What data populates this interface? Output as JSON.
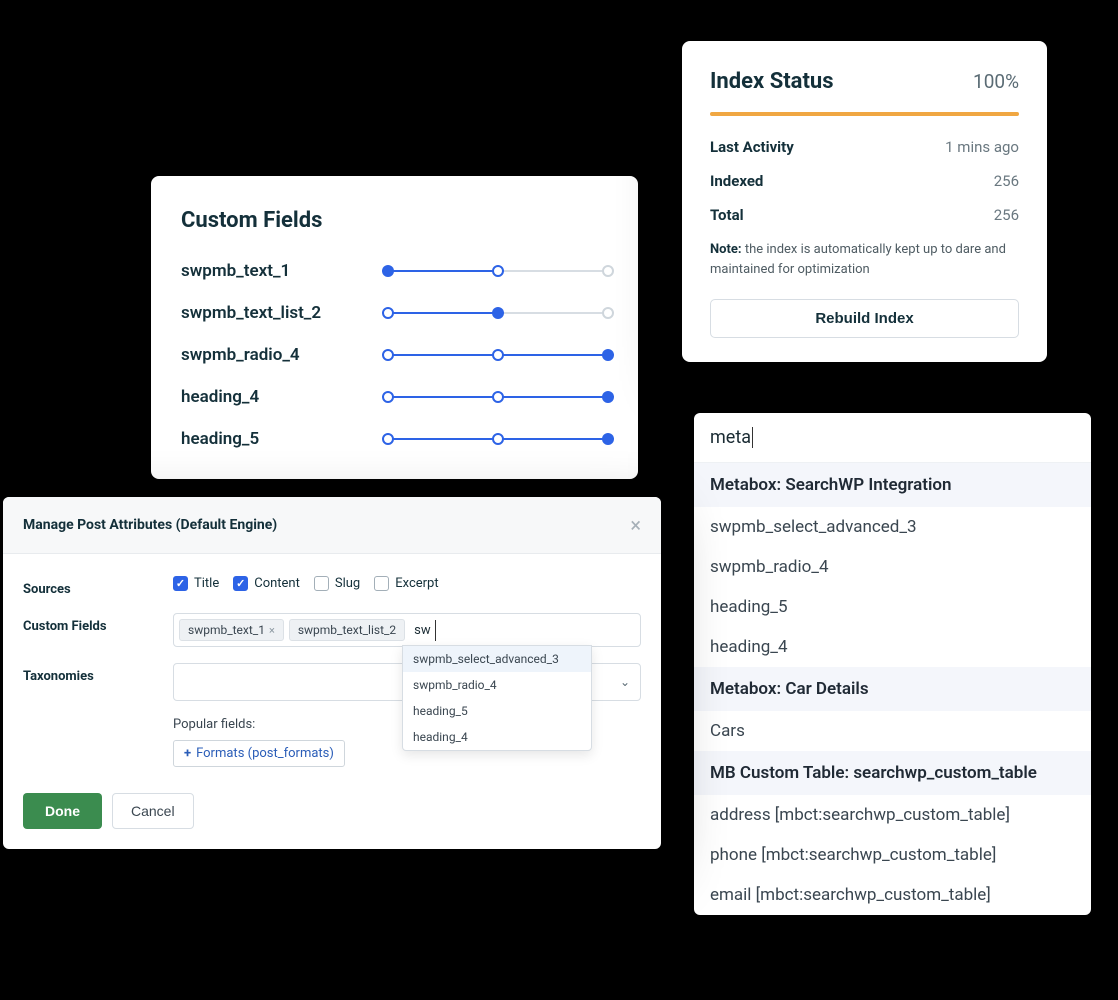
{
  "custom_fields_panel": {
    "title": "Custom Fields",
    "rows": [
      {
        "label": "swpmb_text_1",
        "fill_pct": 50,
        "dots": [
          {
            "type": "filled",
            "pos": 0
          },
          {
            "type": "open",
            "pos": 50
          },
          {
            "type": "grey",
            "pos": 100
          }
        ]
      },
      {
        "label": "swpmb_text_list_2",
        "fill_pct": 50,
        "dots": [
          {
            "type": "open",
            "pos": 0
          },
          {
            "type": "filled",
            "pos": 50
          },
          {
            "type": "grey",
            "pos": 100
          }
        ]
      },
      {
        "label": "swpmb_radio_4",
        "fill_pct": 100,
        "dots": [
          {
            "type": "open",
            "pos": 0
          },
          {
            "type": "open",
            "pos": 50
          },
          {
            "type": "filled",
            "pos": 100
          }
        ]
      },
      {
        "label": "heading_4",
        "fill_pct": 100,
        "dots": [
          {
            "type": "open",
            "pos": 0
          },
          {
            "type": "open",
            "pos": 50
          },
          {
            "type": "filled",
            "pos": 100
          }
        ]
      },
      {
        "label": "heading_5",
        "fill_pct": 100,
        "dots": [
          {
            "type": "open",
            "pos": 0
          },
          {
            "type": "open",
            "pos": 50
          },
          {
            "type": "filled",
            "pos": 100
          }
        ]
      }
    ]
  },
  "index_status": {
    "title": "Index Status",
    "percent": "100%",
    "rows": [
      {
        "label": "Last Activity",
        "value": "1 mins ago"
      },
      {
        "label": "Indexed",
        "value": "256"
      },
      {
        "label": "Total",
        "value": "256"
      }
    ],
    "note_bold": "Note:",
    "note_text": " the index is automatically kept up to dare and maintained for optimization",
    "button": "Rebuild Index"
  },
  "autocomplete": {
    "query": "meta",
    "groups": [
      {
        "header": "Metabox: SearchWP Integration",
        "items": [
          "swpmb_select_advanced_3",
          "swpmb_radio_4",
          "heading_5",
          "heading_4"
        ]
      },
      {
        "header": "Metabox: Car Details",
        "items": [
          "Cars"
        ]
      },
      {
        "header": "MB Custom Table: searchwp_custom_table",
        "items": [
          "address [mbct:searchwp_custom_table]",
          "phone [mbct:searchwp_custom_table]",
          "email [mbct:searchwp_custom_table]"
        ]
      }
    ]
  },
  "modal": {
    "title": "Manage Post Attributes (Default Engine)",
    "sources_label": "Sources",
    "sources": [
      {
        "label": "Title",
        "checked": true
      },
      {
        "label": "Content",
        "checked": true
      },
      {
        "label": "Slug",
        "checked": false
      },
      {
        "label": "Excerpt",
        "checked": false
      }
    ],
    "cf_label": "Custom Fields",
    "cf_tokens": [
      "swpmb_text_1",
      "swpmb_text_list_2"
    ],
    "cf_typed": "sw",
    "cf_suggestions": [
      "swpmb_select_advanced_3",
      "swpmb_radio_4",
      "heading_5",
      "heading_4"
    ],
    "tax_label": "Taxonomies",
    "popular_label": "Popular fields:",
    "format_btn": "Formats (post_formats)",
    "done": "Done",
    "cancel": "Cancel"
  }
}
